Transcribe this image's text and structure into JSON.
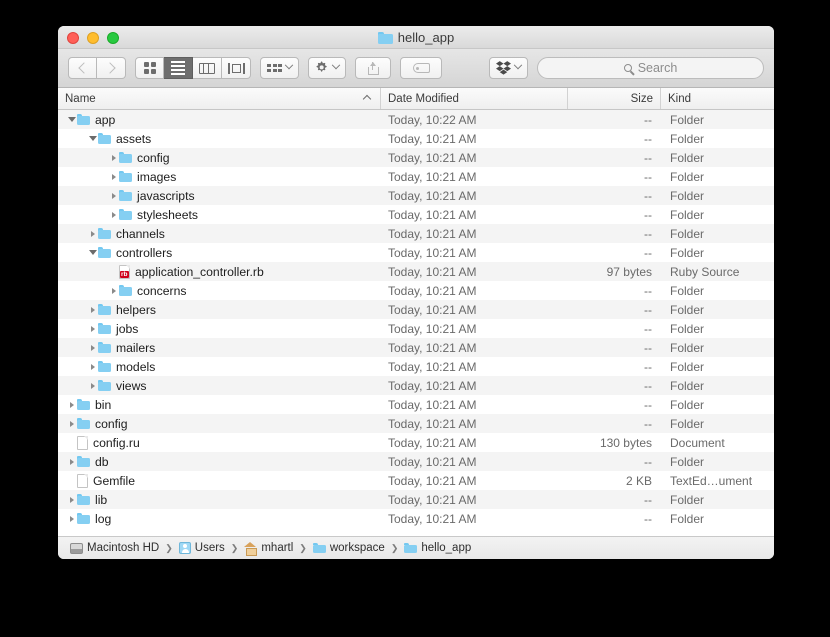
{
  "window": {
    "title": "hello_app",
    "title_icon": "folder-icon",
    "traffic_lights": [
      "close-button",
      "minimize-button",
      "maximize-button"
    ]
  },
  "toolbar": {
    "back_label": "",
    "forward_label": "",
    "view_modes": [
      {
        "name": "icon-view",
        "active": false
      },
      {
        "name": "list-view",
        "active": true
      },
      {
        "name": "column-view",
        "active": false
      },
      {
        "name": "gallery-view",
        "active": false
      }
    ],
    "arrange_label": "",
    "action_label": "",
    "share_label": "",
    "tag_label": "",
    "dropbox_label": ""
  },
  "search": {
    "placeholder": "Search",
    "value": ""
  },
  "columns": [
    {
      "label": "Name",
      "sorted": "asc"
    },
    {
      "label": "Date Modified",
      "sorted": ""
    },
    {
      "label": "Size",
      "sorted": ""
    },
    {
      "label": "Kind",
      "sorted": ""
    }
  ],
  "rows": [
    {
      "name": "app",
      "depth": 0,
      "state": "open",
      "icon": "folder",
      "date": "Today, 10:22 AM",
      "size": "--",
      "kind": "Folder"
    },
    {
      "name": "assets",
      "depth": 1,
      "state": "open",
      "icon": "folder",
      "date": "Today, 10:21 AM",
      "size": "--",
      "kind": "Folder"
    },
    {
      "name": "config",
      "depth": 2,
      "state": "closed",
      "icon": "folder",
      "date": "Today, 10:21 AM",
      "size": "--",
      "kind": "Folder"
    },
    {
      "name": "images",
      "depth": 2,
      "state": "closed",
      "icon": "folder",
      "date": "Today, 10:21 AM",
      "size": "--",
      "kind": "Folder"
    },
    {
      "name": "javascripts",
      "depth": 2,
      "state": "closed",
      "icon": "folder",
      "date": "Today, 10:21 AM",
      "size": "--",
      "kind": "Folder"
    },
    {
      "name": "stylesheets",
      "depth": 2,
      "state": "closed",
      "icon": "folder",
      "date": "Today, 10:21 AM",
      "size": "--",
      "kind": "Folder"
    },
    {
      "name": "channels",
      "depth": 1,
      "state": "closed",
      "icon": "folder",
      "date": "Today, 10:21 AM",
      "size": "--",
      "kind": "Folder"
    },
    {
      "name": "controllers",
      "depth": 1,
      "state": "open",
      "icon": "folder",
      "date": "Today, 10:21 AM",
      "size": "--",
      "kind": "Folder"
    },
    {
      "name": "application_controller.rb",
      "depth": 2,
      "state": "none",
      "icon": "ruby-file",
      "date": "Today, 10:21 AM",
      "size": "97 bytes",
      "kind": "Ruby Source"
    },
    {
      "name": "concerns",
      "depth": 2,
      "state": "closed",
      "icon": "folder",
      "date": "Today, 10:21 AM",
      "size": "--",
      "kind": "Folder"
    },
    {
      "name": "helpers",
      "depth": 1,
      "state": "closed",
      "icon": "folder",
      "date": "Today, 10:21 AM",
      "size": "--",
      "kind": "Folder"
    },
    {
      "name": "jobs",
      "depth": 1,
      "state": "closed",
      "icon": "folder",
      "date": "Today, 10:21 AM",
      "size": "--",
      "kind": "Folder"
    },
    {
      "name": "mailers",
      "depth": 1,
      "state": "closed",
      "icon": "folder",
      "date": "Today, 10:21 AM",
      "size": "--",
      "kind": "Folder"
    },
    {
      "name": "models",
      "depth": 1,
      "state": "closed",
      "icon": "folder",
      "date": "Today, 10:21 AM",
      "size": "--",
      "kind": "Folder"
    },
    {
      "name": "views",
      "depth": 1,
      "state": "closed",
      "icon": "folder",
      "date": "Today, 10:21 AM",
      "size": "--",
      "kind": "Folder"
    },
    {
      "name": "bin",
      "depth": 0,
      "state": "closed",
      "icon": "folder",
      "date": "Today, 10:21 AM",
      "size": "--",
      "kind": "Folder"
    },
    {
      "name": "config",
      "depth": 0,
      "state": "closed",
      "icon": "folder",
      "date": "Today, 10:21 AM",
      "size": "--",
      "kind": "Folder"
    },
    {
      "name": "config.ru",
      "depth": 0,
      "state": "none",
      "icon": "document",
      "date": "Today, 10:21 AM",
      "size": "130 bytes",
      "kind": "Document"
    },
    {
      "name": "db",
      "depth": 0,
      "state": "closed",
      "icon": "folder",
      "date": "Today, 10:21 AM",
      "size": "--",
      "kind": "Folder"
    },
    {
      "name": "Gemfile",
      "depth": 0,
      "state": "none",
      "icon": "document",
      "date": "Today, 10:21 AM",
      "size": "2 KB",
      "kind": "TextEd…ument"
    },
    {
      "name": "lib",
      "depth": 0,
      "state": "closed",
      "icon": "folder",
      "date": "Today, 10:21 AM",
      "size": "--",
      "kind": "Folder"
    },
    {
      "name": "log",
      "depth": 0,
      "state": "closed",
      "icon": "folder",
      "date": "Today, 10:21 AM",
      "size": "--",
      "kind": "Folder"
    }
  ],
  "pathbar": {
    "separator": "❯",
    "crumbs": [
      {
        "label": "Macintosh HD",
        "icon": "harddrive-icon"
      },
      {
        "label": "Users",
        "icon": "users-folder-icon"
      },
      {
        "label": "mhartl",
        "icon": "home-folder-icon"
      },
      {
        "label": "workspace",
        "icon": "folder-icon"
      },
      {
        "label": "hello_app",
        "icon": "folder-icon"
      }
    ]
  },
  "colors": {
    "folder_blue": "#85cff2",
    "ruby_red": "#d0021b",
    "accent_active": "#6e6e6e",
    "row_alt": "#f4f4f4"
  }
}
